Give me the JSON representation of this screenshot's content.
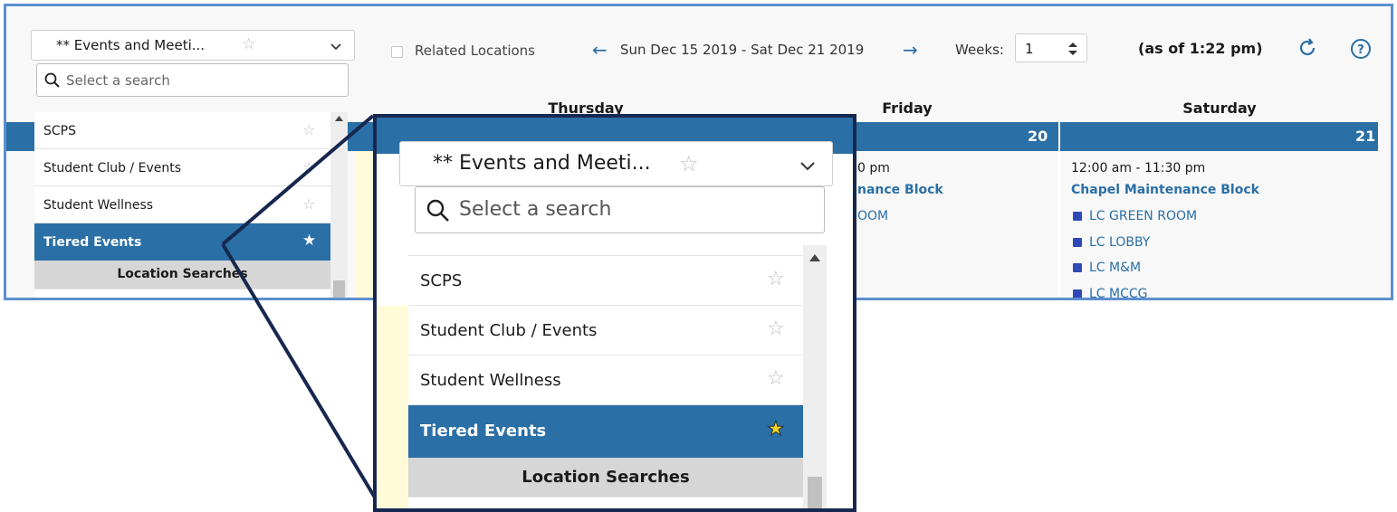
{
  "toolbar": {
    "saved_search": "** Events and Meeti...",
    "search_placeholder": "Select a search",
    "related_locations_label": "Related Locations",
    "date_range": "Sun Dec 15 2019 - Sat Dec 21 2019",
    "prev_arrow": "←",
    "next_arrow": "→",
    "weeks_label": "Weeks:",
    "weeks_value": "1",
    "as_of": "(as of 1:22 pm)"
  },
  "dropdown": {
    "items": [
      {
        "label": "SCPS",
        "favorite": false
      },
      {
        "label": "Student Club / Events",
        "favorite": false
      },
      {
        "label": "Student Wellness",
        "favorite": false
      },
      {
        "label": "Tiered Events",
        "favorite": true,
        "selected": true
      }
    ],
    "section_header": "Location Searches"
  },
  "calendar": {
    "days": [
      {
        "name": "Thursday",
        "date": ""
      },
      {
        "name": "Friday",
        "date": "20"
      },
      {
        "name": "Saturday",
        "date": "21"
      }
    ],
    "friday_partial": {
      "time": "0 pm",
      "title": "nance Block",
      "room": "OOM"
    },
    "saturday_event": {
      "time": "12:00 am - 11:30 pm",
      "title": "Chapel Maintenance Block",
      "rooms": [
        "LC GREEN ROOM",
        "LC LOBBY",
        "LC M&M",
        "LC MCCG"
      ]
    }
  },
  "colors": {
    "accent": "#2a6fa6",
    "frame_border": "#5b8fcf",
    "zoom_border": "#17284f",
    "favorite_star": "#f1d21e",
    "room_icon": "#2f4ab8",
    "highlight_col": "#fffbd8"
  },
  "icons": {
    "search": "magnifier-icon",
    "refresh": "refresh-icon",
    "help": "help-icon",
    "star_empty": "star-outline-icon",
    "star_filled": "star-filled-icon",
    "chevron": "chevron-down-icon",
    "stepper": "stepper-icon",
    "room": "room-cube-icon"
  }
}
